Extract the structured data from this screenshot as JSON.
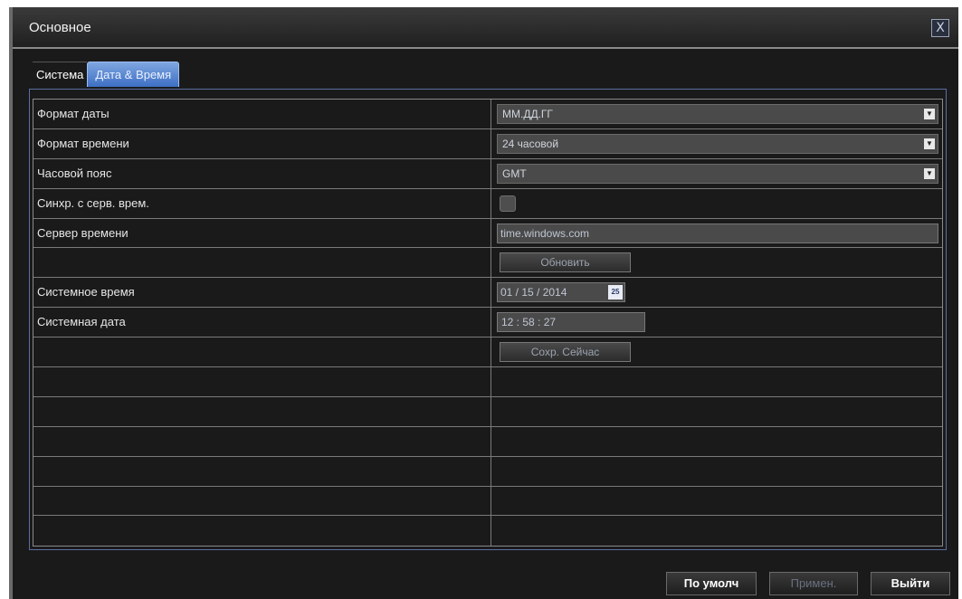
{
  "window": {
    "title": "Основное",
    "close_label": "X"
  },
  "tabs": [
    {
      "label": "Система",
      "active": false
    },
    {
      "label": "Дата & Время",
      "active": true
    }
  ],
  "settings": {
    "date_format": {
      "label": "Формат даты",
      "value": "ММ.ДД.ГГ"
    },
    "time_format": {
      "label": "Формат времени",
      "value": "24 часовой"
    },
    "time_zone": {
      "label": "Часовой пояс",
      "value": "GMT"
    },
    "sync": {
      "label": "Синхр. с серв. врем.",
      "checked": false
    },
    "time_server": {
      "label": "Сервер времени",
      "value": "time.windows.com"
    },
    "update_button": "Обновить",
    "system_time": {
      "label": "Системное время",
      "value": "01 / 15 / 2014",
      "calendar_icon": "25"
    },
    "system_date": {
      "label": "Системная дата",
      "value": "12  :  58  :  27"
    },
    "save_now_button": "Сохр. Сейчас"
  },
  "footer": {
    "default_button": "По умолч",
    "apply_button": "Примен.",
    "exit_button": "Выйти"
  },
  "colors": {
    "background": "#1a1a1a",
    "active_tab": "#4f7fcc",
    "grid_line": "#7a7a7a",
    "panel_border": "#5a6fa0"
  },
  "icons": {
    "close": "close-icon",
    "dropdown": "chevron-down-icon",
    "calendar": "calendar-icon"
  }
}
